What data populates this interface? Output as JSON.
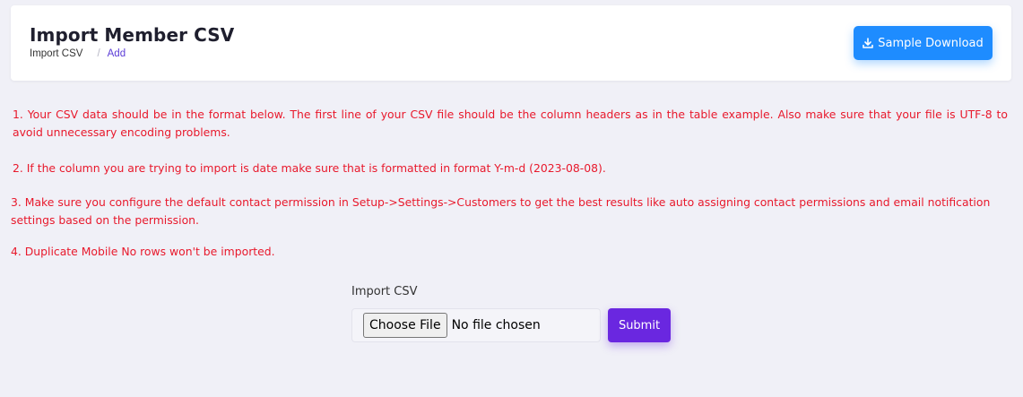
{
  "header": {
    "title": "Import Member CSV",
    "breadcrumb": [
      {
        "label": "Import CSV"
      },
      {
        "label": "Add"
      }
    ],
    "breadcrumb_separator": "/",
    "sample_button_label": "Sample Download",
    "sample_button_icon": "download-icon"
  },
  "notes": [
    "1. Your CSV data should be in the format below. The first line of your CSV file should be the column headers as in the table example. Also make sure that your file is UTF-8 to avoid unnecessary encoding problems.",
    "2. If the column you are trying to import is date make sure that is formatted in format Y-m-d (2023-08-08).",
    "3. Make sure you configure the default contact permission in Setup->Settings->Customers to get the best results like auto assigning contact permissions and email notification settings based on the permission.",
    "4. Duplicate Mobile No rows won't be imported."
  ],
  "form": {
    "label": "Import CSV",
    "choose_file_label": "Choose File",
    "file_status": "No file chosen",
    "submit_label": "Submit"
  },
  "colors": {
    "background": "#f0f0f7",
    "note_text": "#e8192c",
    "primary_blue": "#1e8cff",
    "submit_purple": "#6a27e0",
    "breadcrumb_active": "#5a3bd6"
  }
}
